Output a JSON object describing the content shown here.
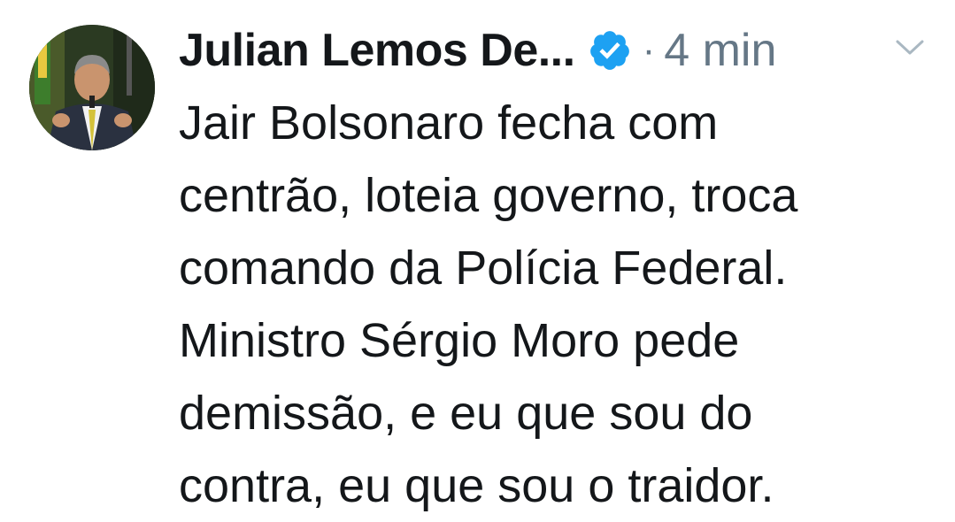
{
  "tweet": {
    "author": {
      "display_name": "Julian Lemos De...",
      "verified": true,
      "avatar_icon": "profile-photo"
    },
    "separator": "·",
    "timestamp": "4 min",
    "menu_icon": "chevron-down-icon",
    "text_lines": [
      "Jair Bolsonaro fecha com",
      "centrão, loteia governo, troca",
      "comando da Polícia Federal.",
      "Ministro Sérgio Moro pede",
      "demissão, e eu que sou do",
      "contra, eu que sou o traidor."
    ]
  },
  "colors": {
    "text": "#14171a",
    "muted": "#657786",
    "verified_blue": "#1da1f2"
  }
}
